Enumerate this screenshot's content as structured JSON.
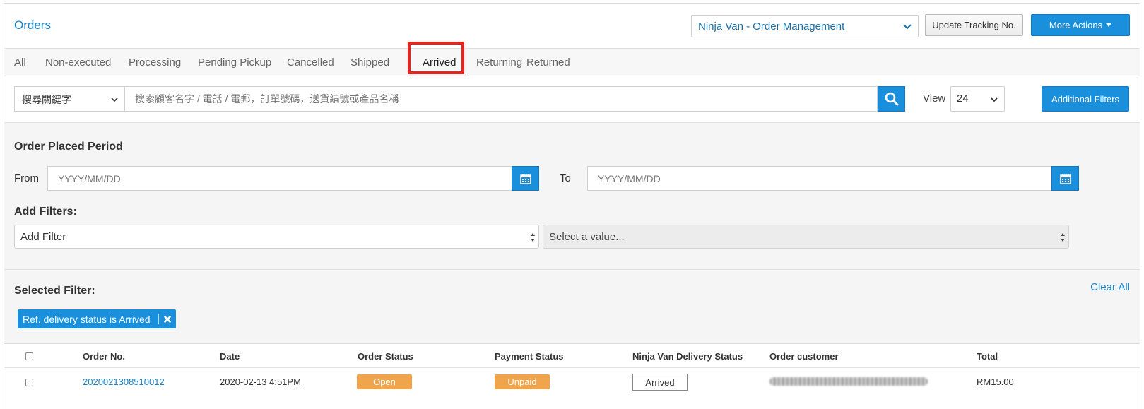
{
  "header": {
    "title": "Orders",
    "store_select": "Ninja Van - Order Management",
    "update_tracking_label": "Update Tracking No.",
    "more_actions_label": "More Actions"
  },
  "tabs": [
    {
      "label": "All"
    },
    {
      "label": "Non-executed"
    },
    {
      "label": "Processing"
    },
    {
      "label": "Pending Pickup"
    },
    {
      "label": "Cancelled"
    },
    {
      "label": "Shipped"
    },
    {
      "label": "Arrived",
      "active": true
    },
    {
      "label": "Returning"
    },
    {
      "label": "Returned"
    }
  ],
  "search": {
    "keyword_select": "搜尋關鍵字",
    "placeholder": "搜索顧客名字 / 電話 / 電郵，訂單號碼，送貨編號或產品名稱",
    "view_label": "View",
    "view_value": "24",
    "additional_filters_label": "Additional Filters"
  },
  "filters": {
    "period_title": "Order Placed Period",
    "from_label": "From",
    "to_label": "To",
    "date_placeholder": "YYYY/MM/DD",
    "add_filters_title": "Add Filters:",
    "add_filter_value": "Add Filter",
    "value_placeholder": "Select a value..."
  },
  "selected": {
    "title": "Selected Filter:",
    "clear_all_label": "Clear All",
    "chip_label": "Ref. delivery status is Arrived"
  },
  "table": {
    "columns": [
      "Order No.",
      "Date",
      "Order Status",
      "Payment Status",
      "Ninja Van Delivery Status",
      "Order customer",
      "Total"
    ],
    "rows": [
      {
        "order_no": "2020021308510012",
        "date": "2020-02-13 4:51PM",
        "order_status": "Open",
        "payment_status": "Unpaid",
        "delivery_status": "Arrived",
        "total": "RM15.00"
      }
    ]
  },
  "colors": {
    "primary": "#1a8fdc",
    "link": "#1a82c4",
    "badge_orange": "#f0a44b",
    "highlight_red": "#e8231d"
  }
}
